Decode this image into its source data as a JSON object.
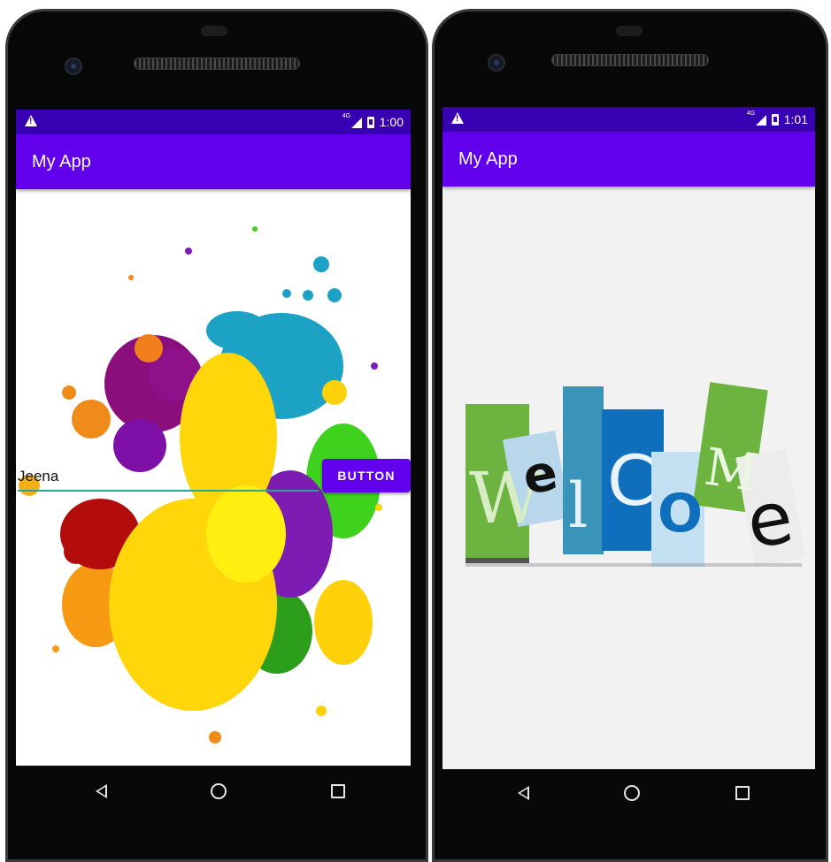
{
  "left_device": {
    "status_bar": {
      "time": "1:00",
      "network": "4G"
    },
    "app_bar": {
      "title": "My App"
    },
    "input": {
      "value": "Jeena"
    },
    "button": {
      "label": "BUTTON"
    }
  },
  "right_device": {
    "status_bar": {
      "time": "1:01",
      "network": "4G"
    },
    "app_bar": {
      "title": "My App"
    },
    "welcome_letters": [
      "W",
      "e",
      "l",
      "C",
      "O",
      "M",
      "e"
    ]
  },
  "colors": {
    "status_bar": "#3700b3",
    "app_bar": "#6200ee",
    "button": "#6200ee",
    "input_underline": "#26a69a"
  },
  "icons": [
    "warning-icon",
    "signal-icon",
    "battery-icon",
    "back-icon",
    "home-icon",
    "recents-icon",
    "camera-icon",
    "speaker-icon"
  ]
}
